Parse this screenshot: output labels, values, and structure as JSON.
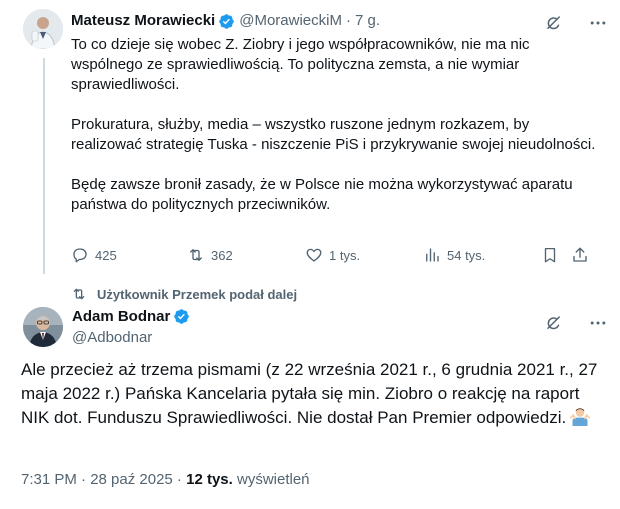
{
  "colors": {
    "accent": "#1d9bf0",
    "secondary_text": "#536471",
    "primary_text": "#0f1419",
    "divider": "#cfd9de"
  },
  "quoted_tweet": {
    "author_name": "Mateusz Morawiecki",
    "handle": "@MorawieckiM",
    "separator": "·",
    "time": "7 g.",
    "paragraphs": [
      "To co dzieje się wobec Z. Ziobry i jego współpracowników, nie ma nic wspólnego ze sprawiedliwością. To polityczna zemsta, a nie wymiar sprawiedliwości.",
      "Prokuratura, służby, media – wszystko ruszone jednym rozkazem, by realizować strategię Tuska - niszczenie PiS i przykrywanie swojej nieudolności.",
      "Będę zawsze bronił zasady, że w Polsce nie można wykorzystywać aparatu państwa do politycznych przeciwników."
    ],
    "actions": {
      "replies": "425",
      "retweets": "362",
      "likes": "1 tys.",
      "views": "54 tys."
    },
    "icons": [
      "verified-badge-icon",
      "grok-icon",
      "more-icon",
      "reply-icon",
      "retweet-icon",
      "like-icon",
      "views-icon",
      "bookmark-icon",
      "share-icon"
    ]
  },
  "retweet_context": {
    "label": "Użytkownik Przemek podał dalej"
  },
  "main_tweet": {
    "author_name": "Adam Bodnar",
    "handle": "@Adbodnar",
    "text": "Ale przecież aż trzema pismami (z 22 września 2021 r., 6 grudnia 2021 r., 27 maja 2022 r.) Pańska Kancelaria pytała się min. Ziobro o reakcję na raport NIK dot. Funduszu Sprawiedliwości. Nie dostał Pan Premier odpowiedzi.",
    "emoji": "person-shrugging-emoji",
    "timestamp": "7:31 PM · 28 paź 2025",
    "meta_separator": " · ",
    "views_count": "12 tys.",
    "views_label": " wyświetleń"
  }
}
